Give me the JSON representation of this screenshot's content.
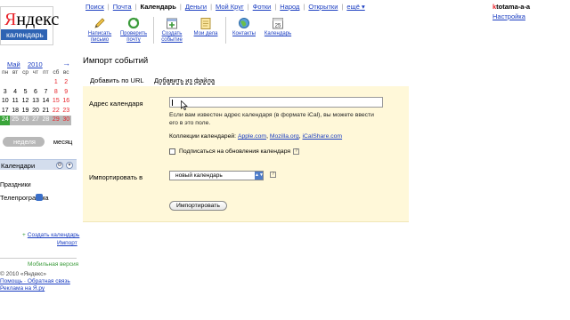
{
  "logo": {
    "brand_first": "Я",
    "brand_rest": "ндекс",
    "product": "календарь"
  },
  "topnav": {
    "items": [
      "Поиск",
      "Почта",
      "Календарь",
      "Деньги",
      "Мой Круг",
      "Фотки",
      "Народ",
      "Открытки",
      "ещё ▾"
    ],
    "current": "Календарь"
  },
  "user": {
    "first": "k",
    "rest": "totama-a-a",
    "settings": "Настройка"
  },
  "toolbar": {
    "write_letter": "Написать письмо",
    "check_mail": "Проверить почту",
    "create_event": "Создать событие",
    "my_tasks": "Мои дела",
    "contacts": "Контакты",
    "calendar": "Календарь",
    "calendar_day": "25"
  },
  "mini_calendar": {
    "month": "Май",
    "year": "2010",
    "prev": "←",
    "next": "→",
    "weekdays": [
      "пн",
      "вт",
      "ср",
      "чт",
      "пт",
      "сб",
      "вс"
    ],
    "rows": [
      [
        "",
        "",
        "",
        "",
        "",
        "1",
        "2"
      ],
      [
        "3",
        "4",
        "5",
        "6",
        "7",
        "8",
        "9"
      ],
      [
        "10",
        "11",
        "12",
        "13",
        "14",
        "15",
        "16"
      ],
      [
        "17",
        "18",
        "19",
        "20",
        "21",
        "22",
        "23"
      ],
      [
        "24",
        "25",
        "26",
        "27",
        "28",
        "29",
        "30"
      ]
    ]
  },
  "view_toggle": {
    "active": "неделя",
    "other": "месяц"
  },
  "calendars_box": {
    "title": "Календари"
  },
  "sidebar": {
    "item1": "Праздники",
    "item2": "Телепрограмма",
    "add_calendar": "Создать календарь",
    "import": "Импорт",
    "mobile": "Мобильная версия",
    "footer1": "© 2010 «Яндекс»",
    "footer2": "Помощь · Обратная связь",
    "footer3": "Реклама на Я.ру"
  },
  "page": {
    "title": "Импорт событий",
    "tab_url": "Добавить по URL",
    "tab_file": "Добавить из файла"
  },
  "form": {
    "url_label": "Адрес календаря",
    "url_value": "",
    "help_text": "Если вам известен адрес календаря (в формате iCal), вы можете ввести его в это поле.",
    "collections_label": "Коллекции календарей:",
    "collections": [
      "Apple.com",
      "Mozilla.org",
      "iCalShare.com"
    ],
    "subscribe_label": "Подписаться на обновления календаря",
    "import_to_label": "Импортировать в",
    "import_to_value": "новый календарь",
    "import_button": "Импортировать",
    "help_icon": "?"
  }
}
